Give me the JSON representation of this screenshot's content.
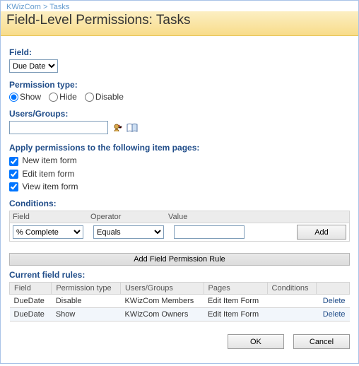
{
  "breadcrumb": {
    "part1": "KWizCom",
    "sep": ">",
    "part2": "Tasks"
  },
  "page_title": "Field-Level Permissions: Tasks",
  "labels": {
    "field": "Field:",
    "permission_type": "Permission type:",
    "users_groups": "Users/Groups:",
    "apply_pages": "Apply permissions to the following item pages:",
    "conditions": "Conditions:",
    "current_rules": "Current field rules:"
  },
  "field_select": {
    "value": "Due Date"
  },
  "permission_radios": {
    "options": [
      {
        "label": "Show",
        "checked": true
      },
      {
        "label": "Hide",
        "checked": false
      },
      {
        "label": "Disable",
        "checked": false
      }
    ]
  },
  "users_groups_value": "",
  "apply_checks": [
    {
      "label": "New item form",
      "checked": true
    },
    {
      "label": "Edit item form",
      "checked": true
    },
    {
      "label": "View item form",
      "checked": true
    }
  ],
  "condition_headers": {
    "field": "Field",
    "operator": "Operator",
    "value": "Value"
  },
  "condition_row": {
    "field": "% Complete",
    "operator": "Equals",
    "value": ""
  },
  "buttons": {
    "add": "Add",
    "add_rule": "Add Field Permission Rule",
    "ok": "OK",
    "cancel": "Cancel",
    "delete": "Delete"
  },
  "rules_headers": {
    "field": "Field",
    "ptype": "Permission type",
    "ug": "Users/Groups",
    "pages": "Pages",
    "cond": "Conditions"
  },
  "rules": [
    {
      "field": "DueDate",
      "ptype": "Disable",
      "ug": "KWizCom Members",
      "pages": "Edit Item Form",
      "cond": ""
    },
    {
      "field": "DueDate",
      "ptype": "Show",
      "ug": "KWizCom Owners",
      "pages": "Edit Item Form",
      "cond": ""
    }
  ]
}
